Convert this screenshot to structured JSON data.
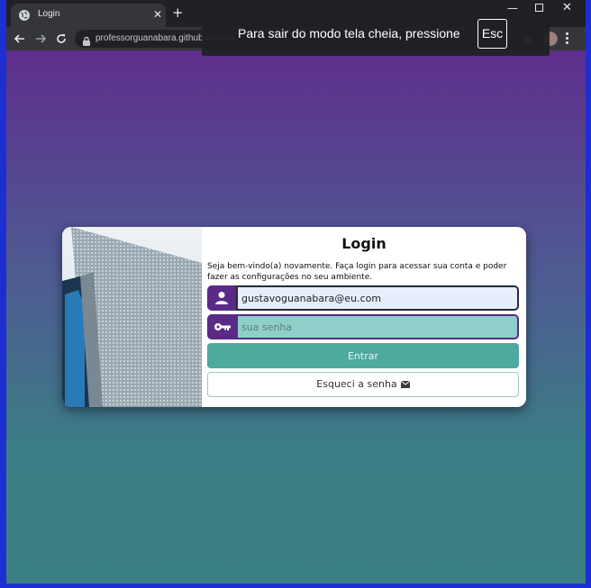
{
  "browser": {
    "tab_title": "Login",
    "url": "professorguanabara.github.io/proje",
    "fullscreen_notice": "Para sair do modo tela cheia, pressione",
    "fullscreen_key": "Esc"
  },
  "login": {
    "title": "Login",
    "welcome": "Seja bem-vindo(a) novamente. Faça login para acessar sua conta e poder fazer as configurações no seu ambiente.",
    "email_value": "gustavoguanabara@eu.com",
    "password_placeholder": "sua senha",
    "submit_label": "Entrar",
    "forgot_label": "Esqueci a senha"
  },
  "colors": {
    "accent_purple": "#5a2a87",
    "button_teal": "#4ea99e",
    "password_field_bg": "#8fcfca"
  },
  "icons": [
    "globe-icon",
    "lock-icon",
    "user-icon",
    "key-icon",
    "mail-icon",
    "puzzle-icon"
  ]
}
